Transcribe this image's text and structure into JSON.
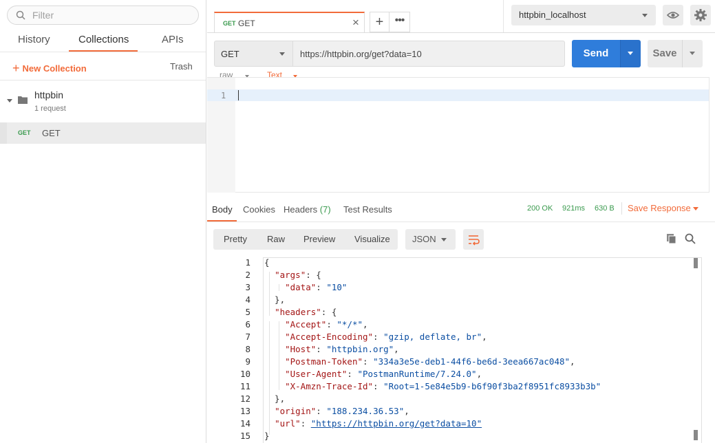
{
  "sidebar": {
    "filter_placeholder": "Filter",
    "tabs": [
      {
        "label": "History"
      },
      {
        "label": "Collections",
        "active": true
      },
      {
        "label": "APIs"
      }
    ],
    "new_collection_label": "New Collection",
    "trash_label": "Trash",
    "collection": {
      "name": "httpbin",
      "count": "1 request",
      "request": {
        "method": "GET",
        "name": "GET"
      }
    }
  },
  "tabs": {
    "request_tab": {
      "method": "GET",
      "name": "GET"
    },
    "add_icon": "plus-icon",
    "more_icon": "ellipsis-icon"
  },
  "environment": {
    "selected": "httpbin_localhost"
  },
  "request": {
    "method": "GET",
    "url": "https://httpbin.org/get?data=10",
    "send_label": "Send",
    "save_label": "Save",
    "body_mode": "raw",
    "body_type": "Text",
    "line": "1"
  },
  "response": {
    "tabs": {
      "body": "Body",
      "cookies": "Cookies",
      "headers": "Headers",
      "headers_count": "(7)",
      "tests": "Test Results"
    },
    "status": "200 OK",
    "time": "921ms",
    "size": "630 B",
    "save_response_label": "Save Response",
    "views": [
      "Pretty",
      "Raw",
      "Preview",
      "Visualize"
    ],
    "format": "JSON",
    "lines": [
      "1",
      "2",
      "3",
      "4",
      "5",
      "6",
      "7",
      "8",
      "9",
      "10",
      "11",
      "12",
      "13",
      "14",
      "15"
    ],
    "json": {
      "args_key": "\"args\"",
      "data_key": "\"data\"",
      "data_val": "\"10\"",
      "headers_key": "\"headers\"",
      "accept_key": "\"Accept\"",
      "accept_val": "\"*/*\"",
      "enc_key": "\"Accept-Encoding\"",
      "enc_val": "\"gzip, deflate, br\"",
      "host_key": "\"Host\"",
      "host_val": "\"httpbin.org\"",
      "token_key": "\"Postman-Token\"",
      "token_val": "\"334a3e5e-deb1-44f6-be6d-3eea667ac048\"",
      "ua_key": "\"User-Agent\"",
      "ua_val": "\"PostmanRuntime/7.24.0\"",
      "trace_key": "\"X-Amzn-Trace-Id\"",
      "trace_val": "\"Root=1-5e84e5b9-b6f90f3ba2f8951fc8933b3b\"",
      "origin_key": "\"origin\"",
      "origin_val": "\"188.234.36.53\"",
      "url_key": "\"url\"",
      "url_val": "\"https://httpbin.org/get?data=10\""
    }
  },
  "colors": {
    "accent": "#f26b3a",
    "send": "#2f7ddb",
    "success": "#3a9a4e"
  }
}
